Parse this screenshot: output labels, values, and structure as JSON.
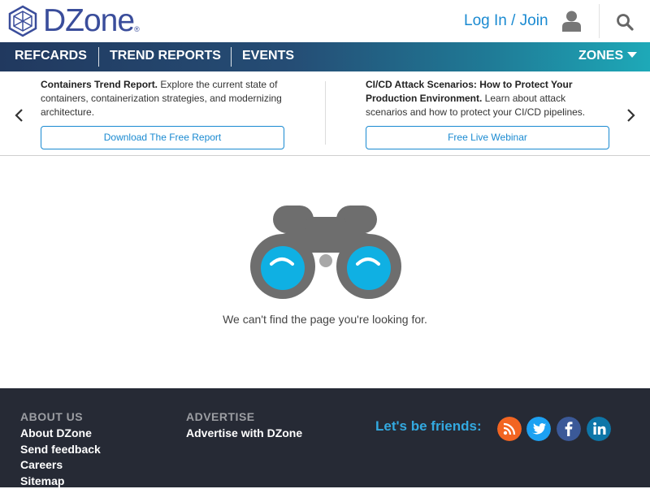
{
  "header": {
    "logo_text": "DZone",
    "logo_reg": "®",
    "login_label": "Log In / Join",
    "icons": [
      "user-icon",
      "search-icon"
    ]
  },
  "nav": {
    "items": [
      "REFCARDS",
      "TREND REPORTS",
      "EVENTS"
    ],
    "zones_label": "ZONES"
  },
  "promos": [
    {
      "title": "Containers Trend Report.",
      "body": " Explore the current state of containers, containerization strategies, and modernizing architecture.",
      "button": "Download The Free Report"
    },
    {
      "title": "CI/CD Attack Scenarios: How to Protect Your Production Environment.",
      "body": " Learn about attack scenarios and how to protect your CI/CD pipelines.",
      "button": "Free Live Webinar"
    }
  ],
  "main": {
    "message": "We can't find the page you're looking for."
  },
  "footer": {
    "about": {
      "heading": "ABOUT US",
      "links": [
        "About DZone",
        "Send feedback",
        "Careers",
        "Sitemap"
      ]
    },
    "advertise": {
      "heading": "ADVERTISE",
      "links": [
        "Advertise with DZone"
      ]
    },
    "friends_label": "Let's be friends:",
    "social": [
      {
        "name": "rss-icon",
        "color": "#f26522"
      },
      {
        "name": "twitter-icon",
        "color": "#1da1f2"
      },
      {
        "name": "facebook-icon",
        "color": "#3b5998"
      },
      {
        "name": "linkedin-icon",
        "color": "#0e76a8"
      }
    ]
  },
  "colors": {
    "brand": "#3a4d9b",
    "link": "#1a8ad1",
    "footer_bg": "#262a35"
  }
}
